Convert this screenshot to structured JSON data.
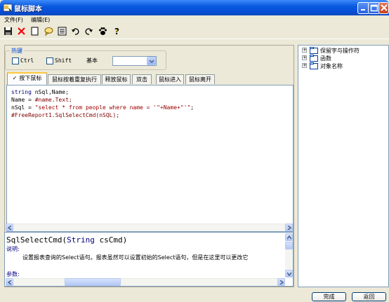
{
  "window": {
    "title": "鼠标脚本"
  },
  "menu": [
    "文件(F)",
    "编辑(E)"
  ],
  "toolbar_icons": [
    "save-icon",
    "delete-icon",
    "new-icon",
    "comment-icon",
    "list-icon",
    "undo-icon",
    "redo-icon",
    "paw-icon",
    "help-icon"
  ],
  "hotkey": {
    "legend": "热键",
    "ctrl_label": "Ctrl",
    "shift_label": "Shift",
    "base_label": "基本",
    "combo_value": ""
  },
  "tabs": [
    {
      "label": "按下鼠标",
      "active": true
    },
    {
      "label": "鼠标按着重复执行"
    },
    {
      "label": "释放鼠标"
    },
    {
      "label": "双击"
    },
    {
      "label": "鼠标进入"
    },
    {
      "label": "鼠标离开"
    }
  ],
  "code": {
    "line1_kw": "string",
    "line1_rest": " nSql,Name;",
    "line2": "Name = ",
    "line2_hash": "#name.Text;",
    "line3_a": "nSql = ",
    "line3_str": "\"select * from people where name = '\"+Name+\"'\"",
    "line3_end": ";",
    "line4": "#FreeReport1.SqlSelectCmd(nSQL);"
  },
  "help": {
    "signature_fn": "SqlSelectCmd(",
    "signature_type": "String",
    "signature_param": " csCmd)",
    "desc_label": "说明:",
    "description": "设置报表查询的Select语句。报表虽然可以设置初始的Select语句，但是在这里可以更改它",
    "params_label": "参数:"
  },
  "tree": [
    {
      "label": "保留字与操作符",
      "selected": true
    },
    {
      "label": "函数"
    },
    {
      "label": "对象名称"
    }
  ],
  "buttons": {
    "ok": "完成",
    "back": "返回"
  },
  "colors": {
    "titlebar": "#0a5adf",
    "keyword": "#000080",
    "string": "#a00000",
    "accent": "#ffc83c"
  }
}
